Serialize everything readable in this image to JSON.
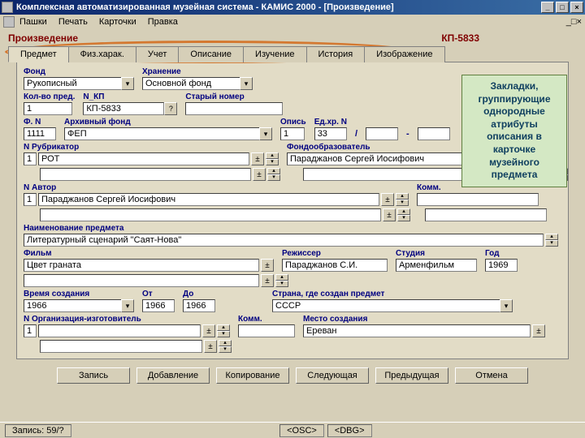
{
  "window": {
    "title": "Комплексная автоматизированная музейная система - КАМИС 2000 - [Произведение]"
  },
  "menu": {
    "items": [
      "Пашки",
      "Печать",
      "Карточки",
      "Правка"
    ]
  },
  "header": {
    "title": "Произведение",
    "kp": "КП-5833"
  },
  "tabs": [
    "Предмет",
    "Физ.харак.",
    "Учет",
    "Описание",
    "Изучение",
    "История",
    "Изображение"
  ],
  "annotation": "Закладки, группирующие однородные атрибуты описания в карточке музейного предмета",
  "labels": {
    "fund": "Фонд",
    "storage": "Хранение",
    "qty": "Кол-во пред.",
    "nkp": "N_КП",
    "old_num": "Старый номер",
    "fn": "Ф. N",
    "arch_fund": "Архивный фонд",
    "opis": "Опись",
    "edkhr": "Ед.хр. N",
    "slash_dash": "/           -",
    "nrub": "N Рубрикатор",
    "fondobr": "Фондообразователь",
    "navtor": "N Автор",
    "komm": "Комм.",
    "naim": "Наименование предмета",
    "film": "Фильм",
    "rezh": "Режиссер",
    "studio": "Студия",
    "god": "Год",
    "vremya": "Время создания",
    "ot": "От",
    "do": "До",
    "strana": "Страна, где создан предмет",
    "norg": "N Организация-изготовитель",
    "mesto": "Место создания"
  },
  "values": {
    "fund": "Рукописный",
    "storage": "Основной фонд",
    "qty": "1",
    "nkp": "КП-5833",
    "old_num": "",
    "fn": "1111",
    "arch_fund": "ФЕП",
    "opis": "1",
    "edkhr": "33",
    "edkhr2": "",
    "edkhr3": "",
    "nrub_n": "1",
    "nrub": "РОТ",
    "nrub2": "",
    "fondobr": "Параджанов Сергей Иосифович",
    "fondobr2": "",
    "navtor_n": "1",
    "navtor": "Параджанов Сергей Иосифович",
    "navtor2": "",
    "komm1": "",
    "komm2": "",
    "naim": "Литературный сценарий \"Саят-Нова\"",
    "film": "Цвет граната",
    "rezh": "Параджанов С.И.",
    "studio": "Арменфильм",
    "god": "1969",
    "vremya": "1966",
    "ot": "1966",
    "do": "1966",
    "strana": "СССР",
    "norg_n": "1",
    "norg": "",
    "komm3": "",
    "mesto": "Ереван"
  },
  "buttons": {
    "bottom": [
      "Запись",
      "Добавление",
      "Копирование",
      "Следующая",
      "Предыдущая",
      "Отмена"
    ]
  },
  "status": {
    "record": "Запись: 59/?",
    "osc": "<OSC>",
    "dbg": "<DBG>"
  }
}
